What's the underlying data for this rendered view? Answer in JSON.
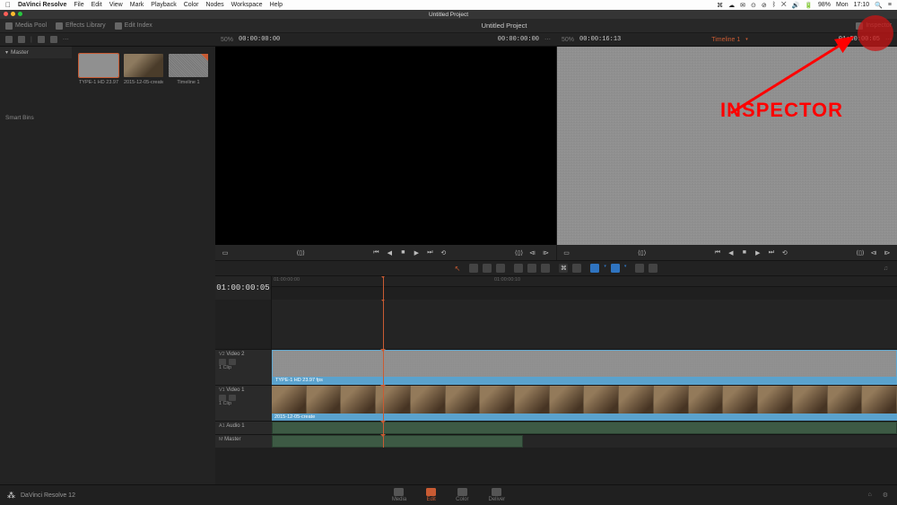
{
  "macos": {
    "app": "DaVinci Resolve",
    "menus": [
      "File",
      "Edit",
      "View",
      "Mark",
      "Playback",
      "Color",
      "Nodes",
      "Workspace",
      "Help"
    ],
    "battery": "98%",
    "day": "Mon",
    "time": "17:10"
  },
  "window": {
    "title": "Untitled Project"
  },
  "toolbar1": {
    "media_pool": "Media Pool",
    "effects_library": "Effects Library",
    "edit_index": "Edit Index",
    "project_title": "Untitled Project",
    "inspector": "Inspector"
  },
  "toolbar2": {
    "left_zoom": "50%",
    "left_tc_in": "00:00:00:00",
    "left_tc_out": "00:00:00:00",
    "right_zoom": "50%",
    "right_tc_in": "00:00:16:13",
    "timeline_label": "Timeline 1",
    "right_tc_out": "01:00:00:05"
  },
  "bins": {
    "master": "Master",
    "smart": "Smart Bins",
    "clips": [
      {
        "name": "TYPE-1 HD 23.97 fps..."
      },
      {
        "name": "2015-12-05-create.m..."
      },
      {
        "name": "Timeline 1"
      }
    ]
  },
  "timeline": {
    "big_tc": "01:00:00:05",
    "ruler": [
      "01:00:00:00",
      "01:00:00:10"
    ],
    "tracks": {
      "v2": {
        "label": "V2",
        "name": "Video 2",
        "count": "1 Clip",
        "clip": "TYPE-1 HD 23.97 fps"
      },
      "v1": {
        "label": "V1",
        "name": "Video 1",
        "count": "1 Clip",
        "clip": "2015-12-05-create"
      },
      "a1": {
        "label": "A1",
        "name": "Audio 1"
      },
      "m": {
        "label": "M",
        "name": "Master"
      }
    }
  },
  "pages": {
    "media": "Media",
    "edit": "Edit",
    "color": "Color",
    "deliver": "Deliver",
    "brand": "DaVinci Resolve 12"
  },
  "annotation": {
    "label": "INSPECTOR"
  }
}
